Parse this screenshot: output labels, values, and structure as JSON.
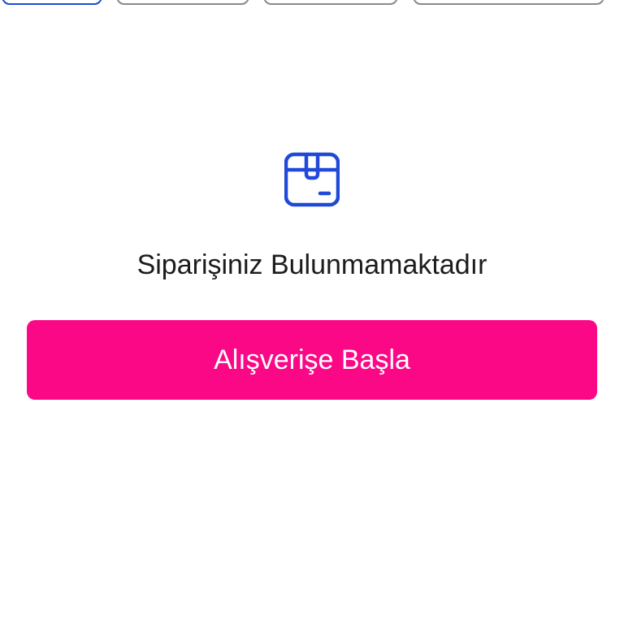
{
  "filter_tabs": [
    {
      "active": true
    },
    {
      "active": false
    },
    {
      "active": false
    },
    {
      "active": false
    }
  ],
  "empty_state": {
    "icon": "package-box-icon",
    "message": "Siparişiniz Bulunmamaktadır"
  },
  "actions": {
    "start_shopping_label": "Alışverişe Başla"
  },
  "colors": {
    "accent_blue": "#1f49d6",
    "button_pink": "#fb0886",
    "text": "#1c1c1c",
    "tab_border": "#8a8a8a"
  }
}
